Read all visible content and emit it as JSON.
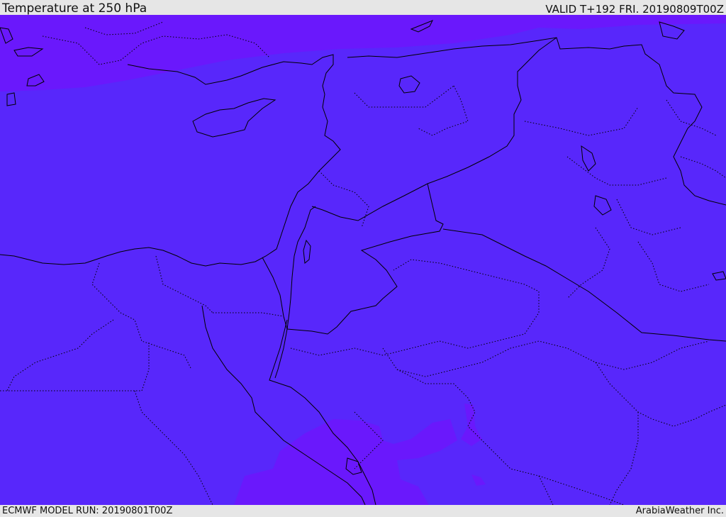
{
  "header": {
    "title": "Temperature at 250 hPa",
    "valid": "VALID T+192 FRI. 20190809T00Z"
  },
  "footer": {
    "model_run": "ECMWF MODEL RUN: 20190801T00Z",
    "credit": "ArabiaWeather Inc."
  },
  "colors": {
    "main_fill": "#5827fb",
    "warm_fill": "#6a18fc",
    "boundaries": "#000000"
  }
}
